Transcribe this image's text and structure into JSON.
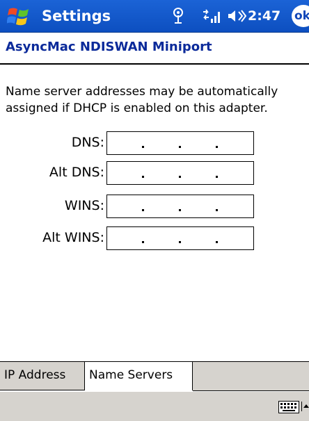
{
  "titlebar": {
    "title": "Settings",
    "clock": "2:47",
    "ok_label": "ok",
    "icons": [
      "windows-start-icon",
      "antenna-icon",
      "signal-icon",
      "speaker-icon"
    ]
  },
  "header": {
    "title": "AsyncMac NDISWAN Miniport"
  },
  "description": "Name server addresses may be automatically assigned if DHCP is enabled on this adapter.",
  "fields": [
    {
      "label": "DNS:",
      "value": ""
    },
    {
      "label": "Alt DNS:",
      "value": ""
    },
    {
      "label": "WINS:",
      "value": ""
    },
    {
      "label": "Alt WINS:",
      "value": ""
    }
  ],
  "tabs": [
    {
      "label": "IP Address",
      "selected": false
    },
    {
      "label": "Name Servers",
      "selected": true
    }
  ],
  "colors": {
    "titlebar": "#1b63d6",
    "header_text": "#0b2a9a",
    "chrome_gray": "#d6d3ce"
  }
}
